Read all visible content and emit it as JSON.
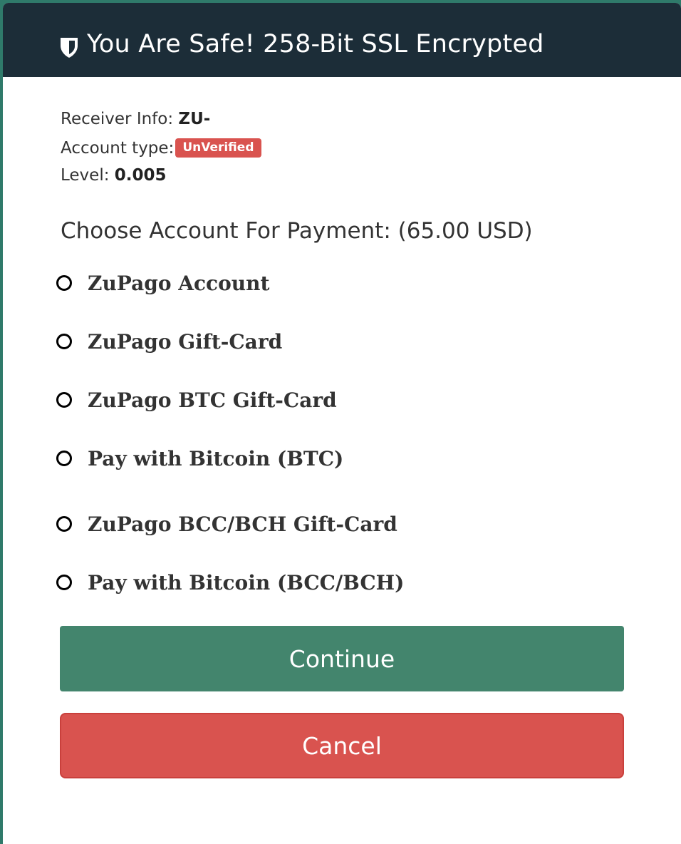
{
  "header": {
    "title": "You Are Safe! 258-Bit SSL Encrypted",
    "icon": "shield-icon"
  },
  "receiver": {
    "info_label": "Receiver Info: ",
    "info_value": "ZU-",
    "account_type_label": "Account type:",
    "account_type_badge": "UnVerified",
    "level_label": "Level: ",
    "level_value": "0.005"
  },
  "payment": {
    "choose_label": "Choose Account For Payment: (65.00 USD)",
    "options": [
      {
        "label": "ZuPago Account"
      },
      {
        "label": "ZuPago Gift-Card"
      },
      {
        "label": "ZuPago BTC Gift-Card"
      },
      {
        "label": "Pay with Bitcoin (BTC)"
      },
      {
        "label": "ZuPago BCC/BCH Gift-Card"
      },
      {
        "label": "Pay with Bitcoin (BCC/BCH)"
      }
    ]
  },
  "buttons": {
    "continue_label": "Continue",
    "cancel_label": "Cancel"
  },
  "colors": {
    "header_bg": "#1c2d38",
    "continue_bg": "#43856d",
    "cancel_bg": "#d9534f",
    "badge_bg": "#d9534f",
    "frame": "#2f7a6a"
  }
}
